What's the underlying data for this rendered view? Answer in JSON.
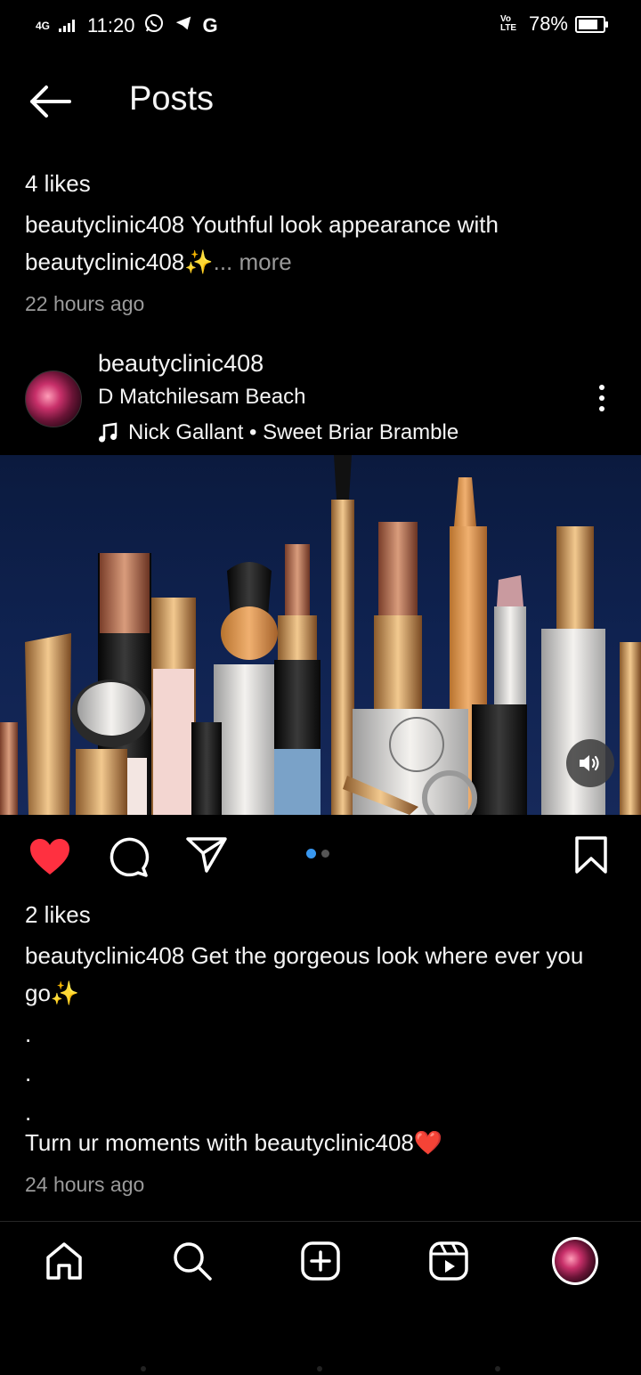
{
  "status_bar": {
    "network": "4G",
    "time": "11:20",
    "app_icons": [
      "whatsapp-icon",
      "telegram-icon",
      "google-icon"
    ],
    "volte": "Vo LTE",
    "battery": "78%"
  },
  "header": {
    "title": "Posts"
  },
  "previous_post": {
    "likes": "4 likes",
    "caption_user": "beautyclinic408",
    "caption_text": " Youthful look appearance with beautyclinic408✨",
    "more": "... more",
    "time": "22 hours ago"
  },
  "post": {
    "username": "beautyclinic408",
    "location": "D Matchilesam Beach",
    "music": "Nick Gallant • Sweet Briar Bramble",
    "carousel_count": 2,
    "carousel_active": 1,
    "liked": true,
    "likes": "2 likes",
    "caption_user": "beautyclinic408",
    "caption_line1": " Get the gorgeous look where ever you go✨",
    "dot1": ".",
    "dot2": ".",
    "dot3": ".",
    "caption_last": "Turn ur moments with beautyclinic408❤️",
    "time": "24 hours ago"
  },
  "colors": {
    "like_red": "#ff3040",
    "accent_blue": "#3897f0",
    "background": "#000000"
  },
  "bottom_nav": [
    "home-icon",
    "search-icon",
    "create-icon",
    "reels-icon",
    "profile-avatar"
  ]
}
